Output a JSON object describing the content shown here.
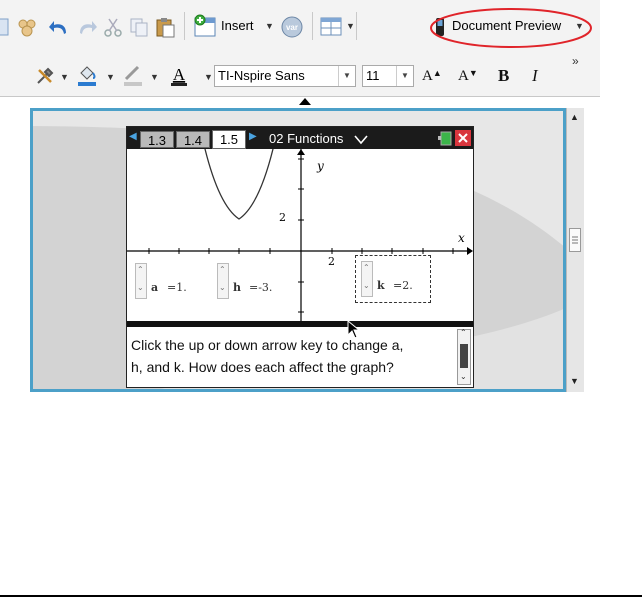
{
  "toolbar1": {
    "insert_label": "Insert",
    "var_label": "var",
    "document_preview_label": "Document Preview",
    "highlight_color": "#e0242a"
  },
  "toolbar2": {
    "font_name": "TI-Nspire Sans",
    "font_size": "11",
    "bold_label": "B",
    "italic_label": "I",
    "overflow_label": "»",
    "font_color_label": "A",
    "font_up_label": "A",
    "font_down_label": "A"
  },
  "device": {
    "tabs": [
      "1.3",
      "1.4",
      "1.5"
    ],
    "active_tab": "1.5",
    "problem_title": "02 Functions",
    "graph": {
      "y_axis_label": "y",
      "x_axis_label": "x",
      "y_tick_label": "2",
      "x_tick_label": "2"
    },
    "sliders": [
      {
        "name": "a",
        "value_text": "=1."
      },
      {
        "name": "h",
        "value_text": "=-3."
      },
      {
        "name": "k",
        "value_text": "=2."
      }
    ],
    "question_line1": "Click the up or down arrow key to change a,",
    "question_line2": "h, and k. How does each affect the graph?"
  },
  "colors": {
    "canvas_border": "#4ca0c8",
    "device_header": "#1b1b1b",
    "battery": "#3cb44a",
    "close_red": "#d9363e"
  }
}
